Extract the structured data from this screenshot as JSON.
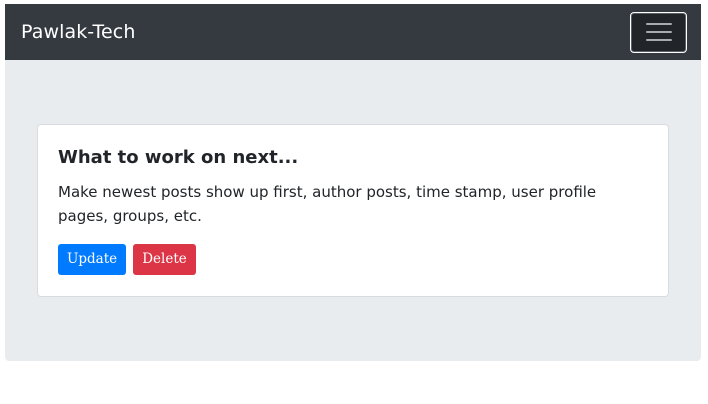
{
  "navbar": {
    "brand": "Pawlak-Tech",
    "toggler_icon": "hamburger-menu-icon"
  },
  "post": {
    "title": "What to work on next...",
    "body": "Make newest posts show up first, author posts, time stamp, user profile pages, groups, etc.",
    "update_label": "Update",
    "delete_label": "Delete"
  },
  "colors": {
    "navbar_bg": "#343a40",
    "page_bg": "#e9ecef",
    "primary": "#007bff",
    "danger": "#dc3545"
  }
}
